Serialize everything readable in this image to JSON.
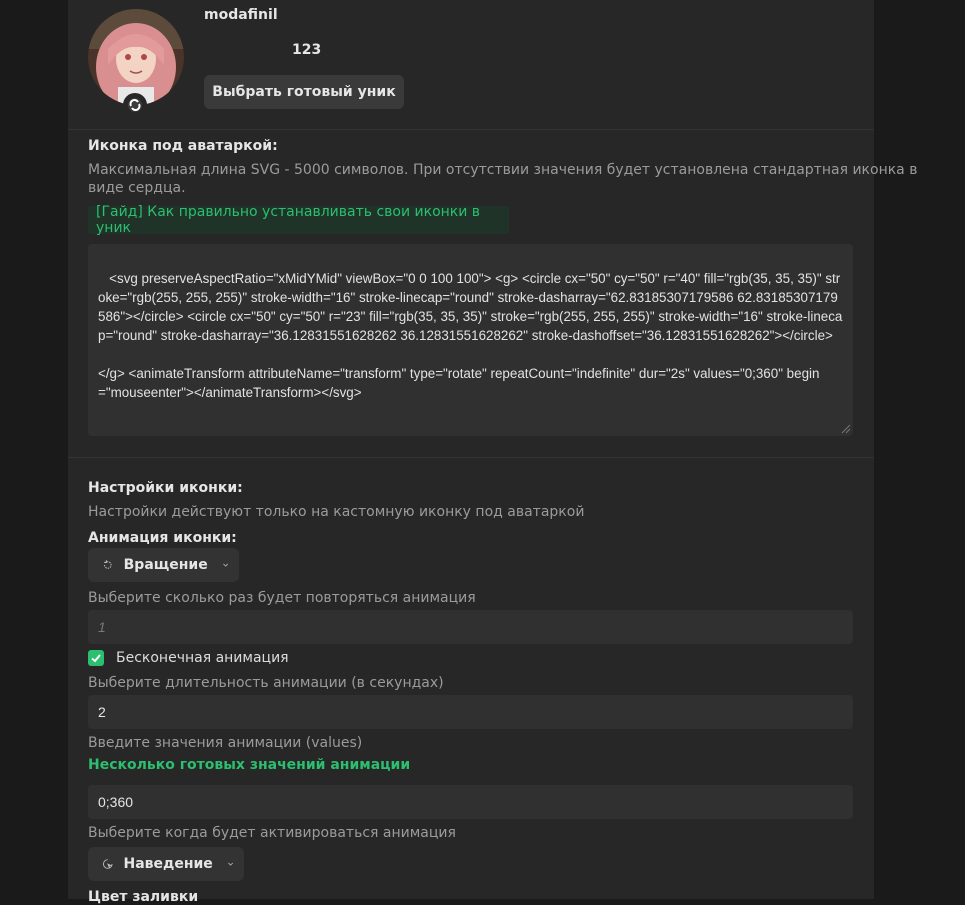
{
  "profile": {
    "username": "modafinil",
    "user_title": "123",
    "choose_uniq_button": "Выбрать готовый уник"
  },
  "icon_section": {
    "title": "Иконка под аватаркой:",
    "description_line1": "Максимальная длина SVG - 5000 символов. При отсутствии значения будет установлена стандартная иконка в",
    "description_line2": "виде сердца.",
    "guide_link": "[Гайд] Как правильно устанавливать свои иконки в уник",
    "svg_value": " <svg preserveAspectRatio=\"xMidYMid\" viewBox=\"0 0 100 100\"> <g> <circle cx=\"50\" cy=\"50\" r=\"40\" fill=\"rgb(35, 35, 35)\" stroke=\"rgb(255, 255, 255)\" stroke-width=\"16\" stroke-linecap=\"round\" stroke-dasharray=\"62.83185307179586 62.83185307179586\"></circle> <circle cx=\"50\" cy=\"50\" r=\"23\" fill=\"rgb(35, 35, 35)\" stroke=\"rgb(255, 255, 255)\" stroke-width=\"16\" stroke-linecap=\"round\" stroke-dasharray=\"36.12831551628262 36.12831551628262\" stroke-dashoffset=\"36.12831551628262\"></circle>\n\n</g> <animateTransform attributeName=\"transform\" type=\"rotate\" repeatCount=\"indefinite\" dur=\"2s\" values=\"0;360\" begin=\"mouseenter\"></animateTransform></svg>"
  },
  "settings": {
    "title": "Настройки иконки:",
    "description": "Настройки действуют только на кастомную иконку под аватаркой",
    "animation_label": "Анимация иконки:",
    "animation_value": "Вращение",
    "repeat_label": "Выберите сколько раз будет повторяться анимация",
    "repeat_placeholder": "1",
    "infinite_label": "Бесконечная анимация",
    "infinite_checked": true,
    "duration_label": "Выберите длительность анимации (в секундах)",
    "duration_value": "2",
    "values_label": "Введите значения анимации (values)",
    "values_link": "Несколько готовых значений анимации",
    "values_value": "0;360",
    "trigger_label": "Выберите когда будет активироваться анимация",
    "trigger_value": "Наведение",
    "fill_label": "Цвет заливки"
  },
  "colors": {
    "accent": "#2bbf6f",
    "panel": "#272727",
    "background": "#1a1a1a"
  }
}
